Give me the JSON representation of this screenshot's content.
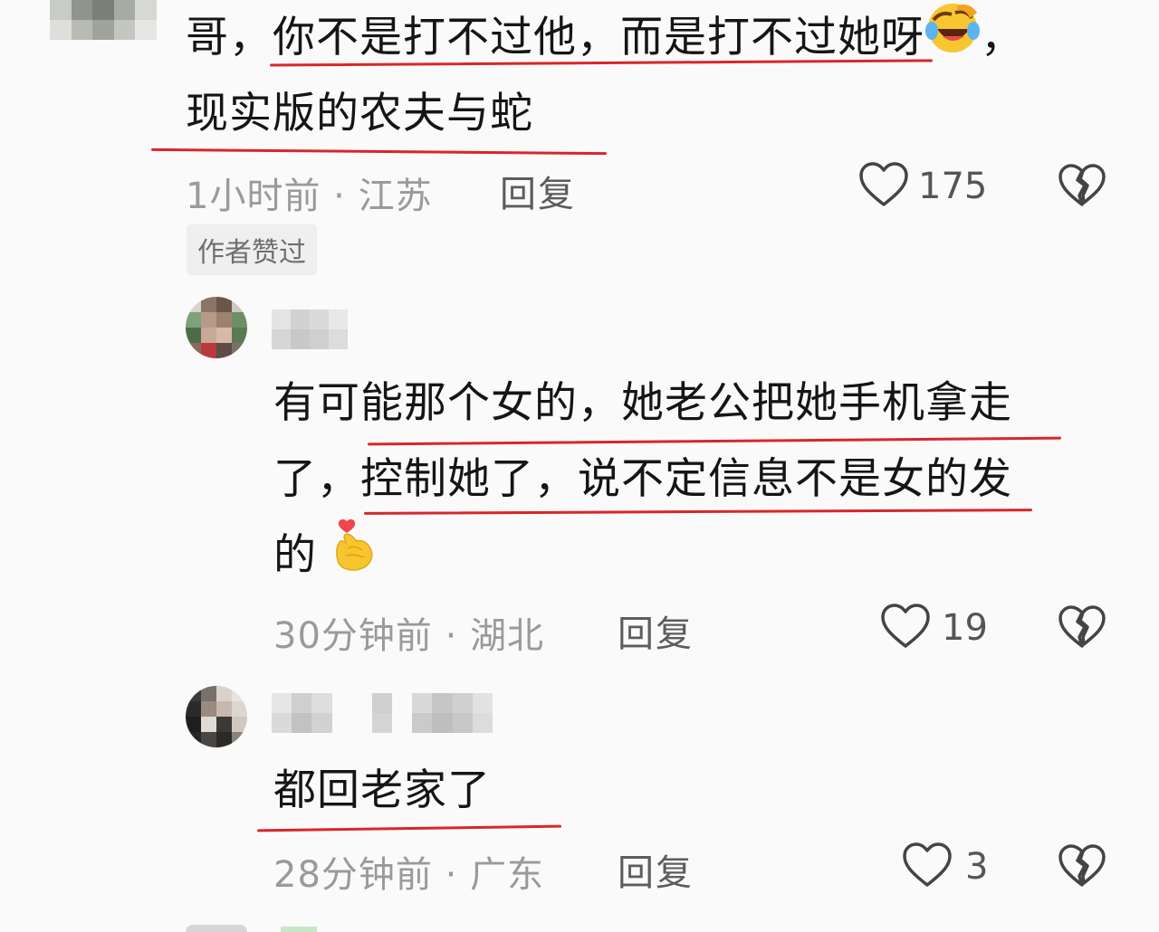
{
  "comments": [
    {
      "text_line1_a": "哥，",
      "text_line1_b": "你不是打不过他，而是打不过她呀",
      "text_line1_emoji": "face-with-tears-of-joy-icon",
      "text_line1_c": "，",
      "text_line2": "现实版的农夫与蛇",
      "time": "1小时前",
      "location": "江苏",
      "reply_label": "回复",
      "likes": "175",
      "badge": "作者赞过"
    },
    {
      "text_line1": "有可能那个女的，她老公把她手机拿走",
      "text_line2": "了，控制她了，说不定信息不是女的发",
      "text_line3": "的",
      "text_line3_emoji": "finger-heart-icon",
      "time": "30分钟前",
      "location": "湖北",
      "reply_label": "回复",
      "likes": "19"
    },
    {
      "text_line1": "都回老家了",
      "time": "28分钟前",
      "location": "广东",
      "reply_label": "回复",
      "likes": "3"
    }
  ],
  "separator": "·",
  "colors": {
    "underline": "#d8262a",
    "meta": "#9a9a9a",
    "text": "#151515",
    "background": "#fafafa"
  }
}
